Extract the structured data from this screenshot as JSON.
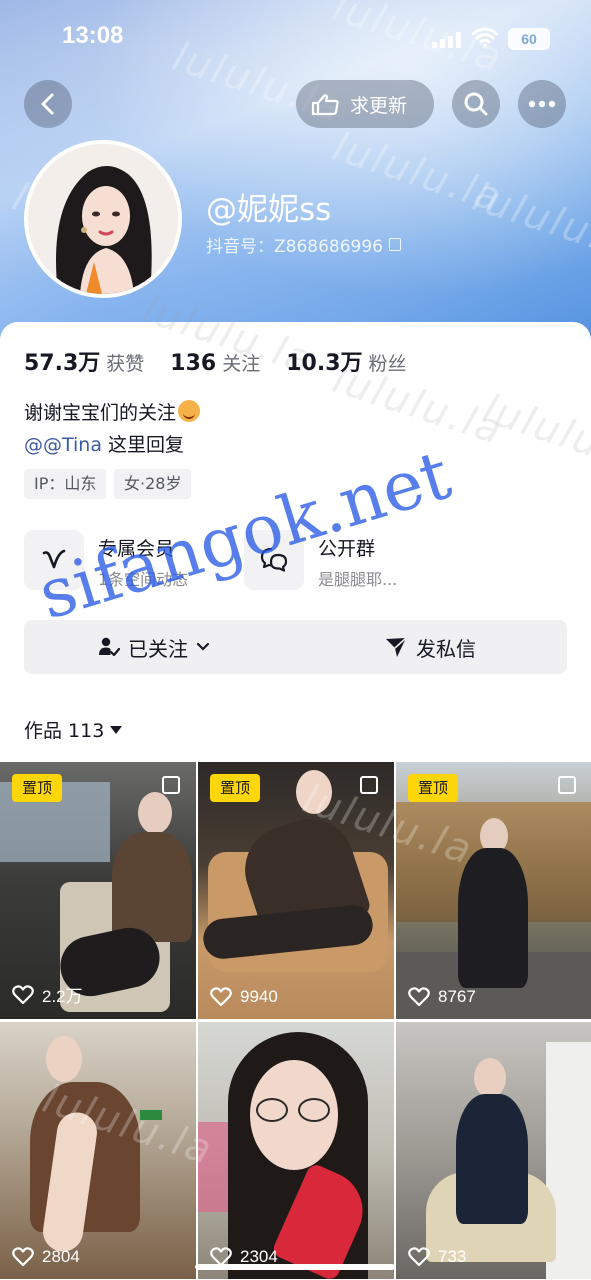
{
  "status_bar": {
    "time": "13:08",
    "battery": "60"
  },
  "header": {
    "request_update_label": "求更新"
  },
  "profile": {
    "nickname": "@妮妮ss",
    "douyin_id": "抖音号：Z868686996"
  },
  "stats": [
    {
      "value": "57.3万",
      "label": "获赞"
    },
    {
      "value": "136",
      "label": "关注"
    },
    {
      "value": "10.3万",
      "label": "粉丝"
    }
  ],
  "bio": {
    "line1": "谢谢宝宝们的关注",
    "mention": "@@Tina",
    "line2_rest": " 这里回复"
  },
  "tags": [
    "IP：山东",
    "女·28岁"
  ],
  "features": [
    {
      "title": "专属会员",
      "subtitle": "1条空间动态"
    },
    {
      "title": "公开群",
      "subtitle": "是腿腿耶..."
    }
  ],
  "actions": {
    "following_label": "已关注",
    "message_label": "发私信"
  },
  "works": {
    "tab_label": "作品 113"
  },
  "videos": [
    {
      "pinned": "置顶",
      "likes": "2.2万"
    },
    {
      "pinned": "置顶",
      "likes": "9940"
    },
    {
      "pinned": "置顶",
      "likes": "8767"
    },
    {
      "pinned": "",
      "likes": "2804"
    },
    {
      "pinned": "",
      "likes": "2304"
    },
    {
      "pinned": "",
      "likes": "733"
    }
  ],
  "watermarks": {
    "site": "sifangok.net",
    "tile": "lululu.la"
  },
  "colors": {
    "pin_badge": "#ffd60a",
    "mention": "#3c5aa6",
    "watermark": "#285ae6"
  }
}
